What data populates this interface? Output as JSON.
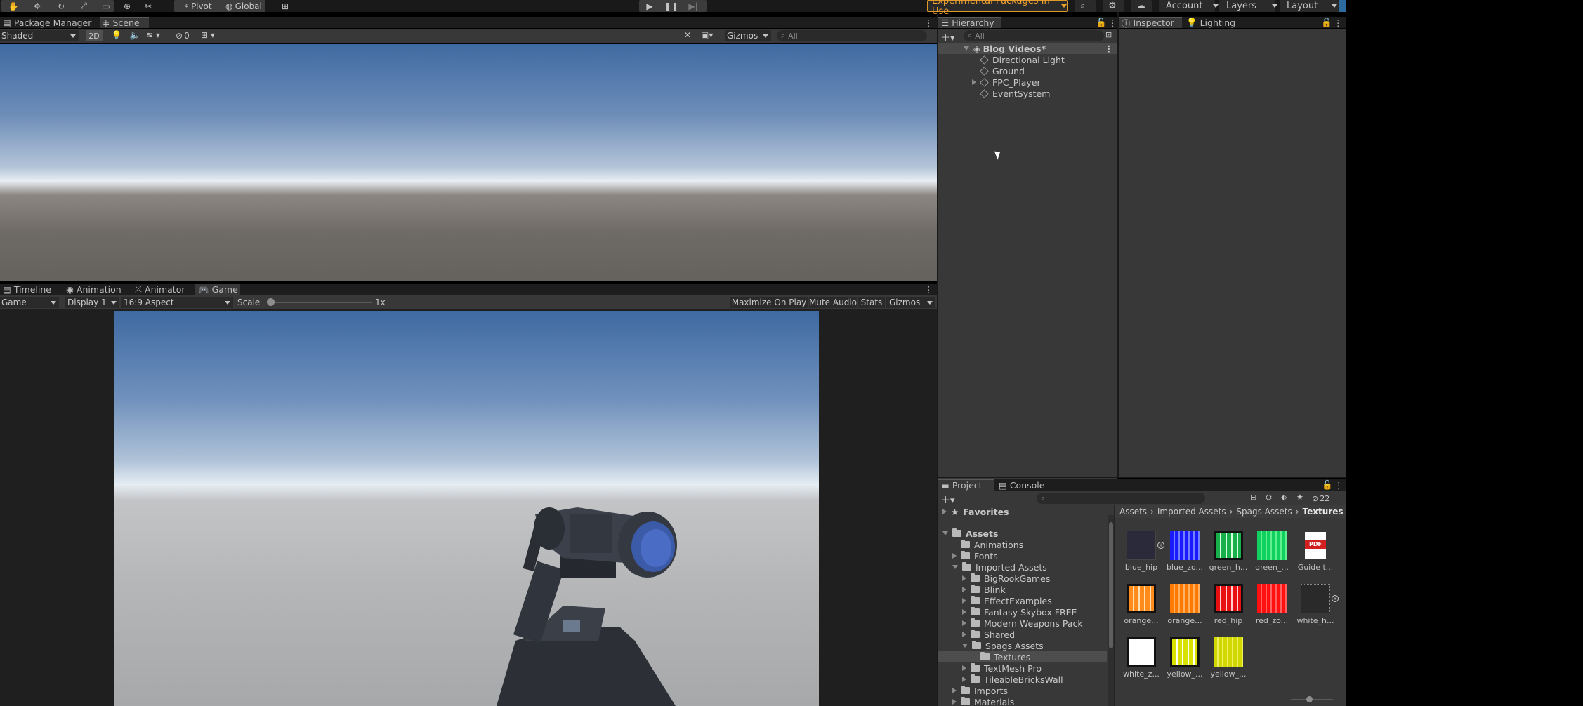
{
  "toolbar": {
    "pivot_label": "Pivot",
    "global_label": "Global",
    "experimental_label": "Experimental Packages In Use",
    "account_label": "Account",
    "layers_label": "Layers",
    "layout_label": "Layout"
  },
  "scene_panel": {
    "tabs": [
      "Package Manager",
      "Scene"
    ],
    "shading_mode": "Shaded",
    "mode_2d_label": "2D",
    "hidden_count": "0",
    "gizmos_label": "Gizmos",
    "search_placeholder": "All"
  },
  "game_panel": {
    "tabs": [
      "Timeline",
      "Animation",
      "Animator",
      "Game"
    ],
    "view_mode": "Game",
    "display": "Display 1",
    "aspect": "16:9 Aspect",
    "scale_label": "Scale",
    "scale_value": 0.0,
    "scale_text": "1x",
    "maximize_label": "Maximize On Play",
    "mute_label": "Mute Audio",
    "stats_label": "Stats",
    "gizmos_label": "Gizmos"
  },
  "hierarchy": {
    "tab": "Hierarchy",
    "search_placeholder": "All",
    "scene_name": "Blog Videos*",
    "items": [
      "Directional Light",
      "Ground",
      "FPC_Player",
      "EventSystem"
    ]
  },
  "inspector": {
    "tabs": [
      "Inspector",
      "Lighting"
    ]
  },
  "project": {
    "tabs": [
      "Project",
      "Console"
    ],
    "hidden_count": "22",
    "favorites_label": "Favorites",
    "tree": [
      "Assets",
      "Animations",
      "Fonts",
      "Imported Assets",
      "BigRookGames",
      "Blink",
      "EffectExamples",
      "Fantasy Skybox FREE",
      "Modern Weapons Pack",
      "Shared",
      "Spags Assets",
      "Textures",
      "TextMesh Pro",
      "TileableBricksWall",
      "Imports",
      "Materials"
    ],
    "breadcrumb": [
      "Assets",
      "Imported Assets",
      "Spags Assets",
      "Textures"
    ],
    "assets": [
      {
        "name": "blue_hip",
        "color": "#2a2a3a"
      },
      {
        "name": "blue_zo...",
        "color": "#1a1aff"
      },
      {
        "name": "green_h...",
        "color": "#18b04a"
      },
      {
        "name": "green_...",
        "color": "#10d060"
      },
      {
        "name": "Guide t...",
        "color": "#ffffff"
      },
      {
        "name": "orange...",
        "color": "#ff8c1a"
      },
      {
        "name": "orange...",
        "color": "#ff7a00"
      },
      {
        "name": "red_hip",
        "color": "#e81010"
      },
      {
        "name": "red_zo...",
        "color": "#ff1010"
      },
      {
        "name": "white_h...",
        "color": "#2a2a2a"
      },
      {
        "name": "white_z...",
        "color": "#ffffff"
      },
      {
        "name": "yellow_...",
        "color": "#d8e000"
      },
      {
        "name": "yellow_...",
        "color": "#d0d800"
      }
    ],
    "pdf_badge": "PDF"
  }
}
